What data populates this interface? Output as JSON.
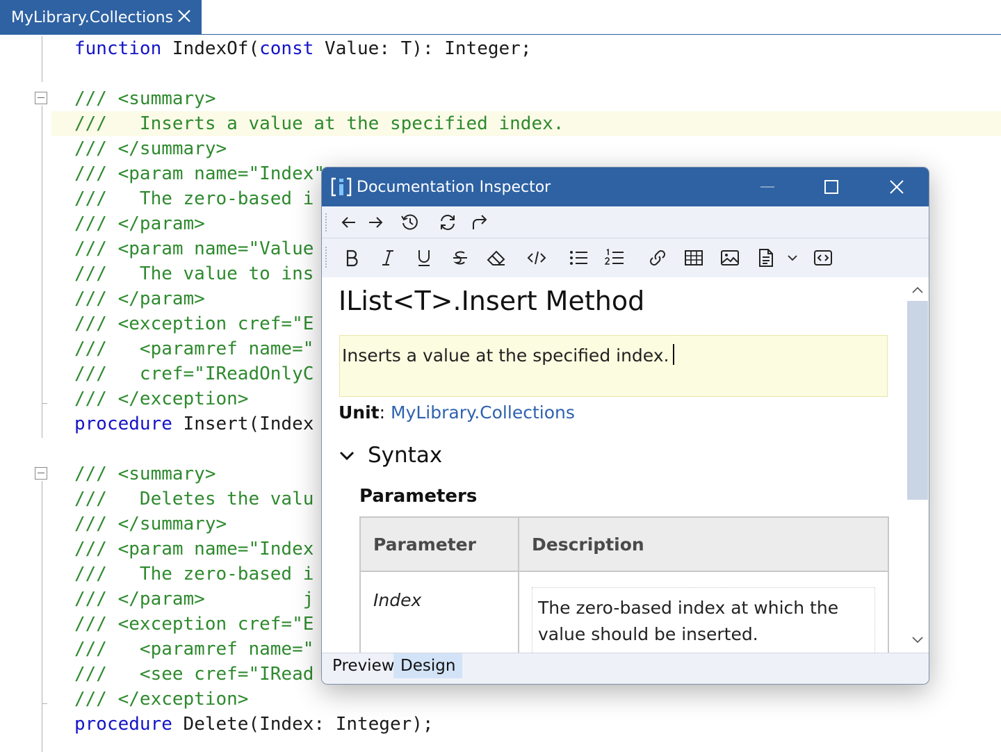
{
  "editor": {
    "tab_label": "MyLibrary.Collections",
    "lines": [
      {
        "type": "code",
        "parts": [
          {
            "t": "function",
            "k": true
          },
          {
            "t": " IndexOf("
          },
          {
            "t": "const",
            "k": true
          },
          {
            "t": " Value: T): Integer;"
          }
        ]
      },
      {
        "type": "blank"
      },
      {
        "type": "comment",
        "text": "/// <summary>"
      },
      {
        "type": "comment",
        "text": "///   Inserts a value at the specified index."
      },
      {
        "type": "comment",
        "text": "/// </summary>"
      },
      {
        "type": "comment",
        "text": "/// <param name=\"Index\""
      },
      {
        "type": "comment",
        "text": "///   The zero-based i"
      },
      {
        "type": "comment",
        "text": "/// </param>"
      },
      {
        "type": "comment",
        "text": "/// <param name=\"Value"
      },
      {
        "type": "comment",
        "text": "///   The value to ins"
      },
      {
        "type": "comment",
        "text": "/// </param>"
      },
      {
        "type": "comment",
        "text": "/// <exception cref=\"E"
      },
      {
        "type": "comment",
        "text": "///   <paramref name=\""
      },
      {
        "type": "comment",
        "text": "///   cref=\"IReadOnlyC"
      },
      {
        "type": "comment",
        "text": "/// </exception>"
      },
      {
        "type": "code",
        "parts": [
          {
            "t": "procedure",
            "k": true
          },
          {
            "t": " Insert(Index"
          }
        ]
      },
      {
        "type": "blank"
      },
      {
        "type": "comment",
        "text": "/// <summary>"
      },
      {
        "type": "comment",
        "text": "///   Deletes the valu"
      },
      {
        "type": "comment",
        "text": "/// </summary>"
      },
      {
        "type": "comment",
        "text": "/// <param name=\"Index"
      },
      {
        "type": "comment",
        "text": "///   The zero-based i"
      },
      {
        "type": "comment",
        "text": "/// </param>         j"
      },
      {
        "type": "comment",
        "text": "/// <exception cref=\"E"
      },
      {
        "type": "comment",
        "text": "///   <paramref name=\""
      },
      {
        "type": "comment",
        "text": "///   <see cref=\"IRead"
      },
      {
        "type": "comment",
        "text": "/// </exception>"
      },
      {
        "type": "code",
        "parts": [
          {
            "t": "procedure",
            "k": true
          },
          {
            "t": " Delete(Index: Integer);"
          }
        ]
      }
    ]
  },
  "inspector": {
    "title": "Documentation Inspector",
    "nav_toolbar": [
      {
        "name": "back-arrow-icon"
      },
      {
        "name": "forward-arrow-icon"
      },
      {
        "name": "history-icon"
      },
      {
        "name": "refresh-icon"
      },
      {
        "name": "redo-icon"
      }
    ],
    "format_toolbar": [
      {
        "name": "bold-icon"
      },
      {
        "name": "italic-icon"
      },
      {
        "name": "underline-icon"
      },
      {
        "name": "strikethrough-icon"
      },
      {
        "name": "eraser-icon"
      },
      {
        "name": "code-icon"
      },
      {
        "name": "bullet-list-icon"
      },
      {
        "name": "numbered-list-icon"
      },
      {
        "name": "link-icon"
      },
      {
        "name": "table-icon"
      },
      {
        "name": "image-icon"
      },
      {
        "name": "document-icon"
      },
      {
        "name": "chevron-down-icon"
      },
      {
        "name": "source-code-icon"
      }
    ],
    "doc_title": "IList<T>.Insert Method",
    "summary": "Inserts a value at the specified index.",
    "unit_label": "Unit",
    "unit_separator": ":",
    "unit_value": "MyLibrary.Collections",
    "syntax_heading": "Syntax",
    "parameters_heading": "Parameters",
    "table_headers": [
      "Parameter",
      "Description"
    ],
    "table_rows": [
      {
        "param": "Index",
        "description": "The zero-based index at which the value should be inserted."
      }
    ],
    "bottom_tabs": [
      {
        "label": "Preview",
        "active": false
      },
      {
        "label": "Design",
        "active": true
      }
    ]
  },
  "colors": {
    "accent": "#2e62a3",
    "keyword": "#1414c8",
    "comment": "#2e8a2e",
    "link": "#2e62b0",
    "summary_bg": "#fcfce0"
  }
}
